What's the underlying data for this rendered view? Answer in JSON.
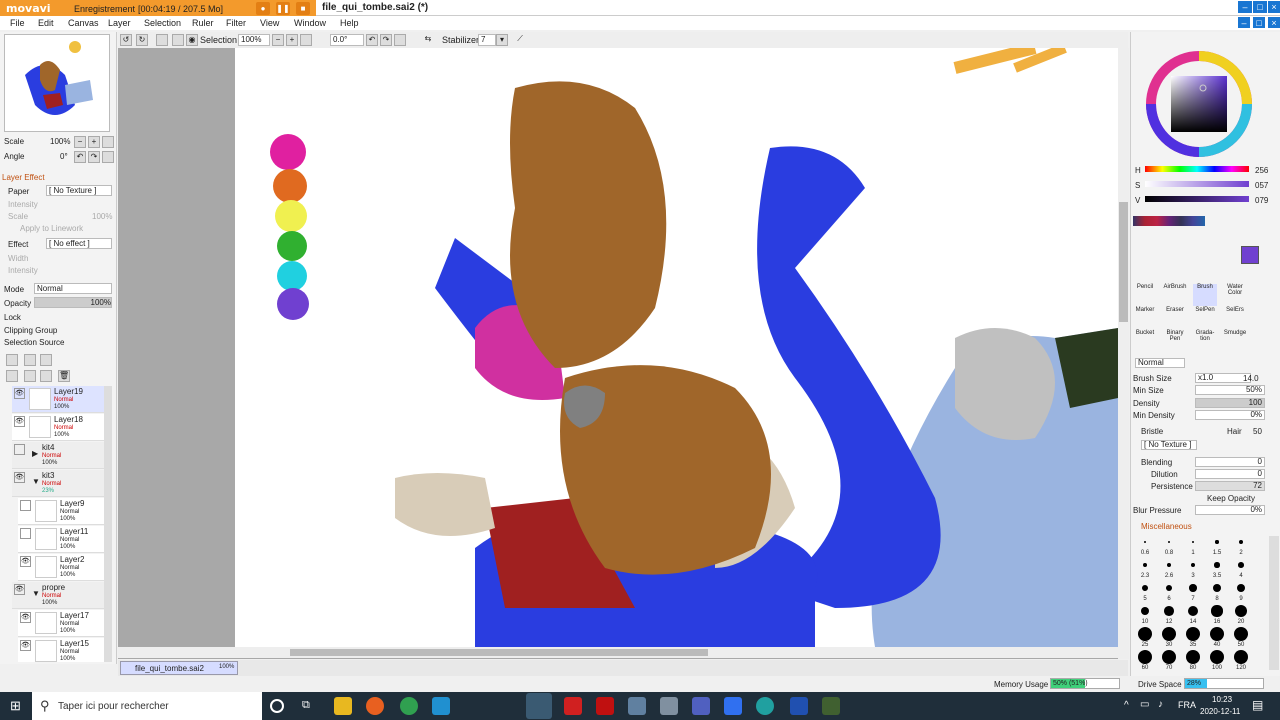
{
  "recorder": {
    "logo": "movavi",
    "label": "Enregistrement",
    "time": "[00:04:19 / 207.5 Mo]"
  },
  "title": "file_qui_tombe.sai2 (*)",
  "menu": [
    "File",
    "Edit",
    "Canvas",
    "Layer",
    "Selection",
    "Ruler",
    "Filter",
    "View",
    "Window",
    "Help"
  ],
  "toolbar": {
    "selection": "Selection",
    "zoom": "100%",
    "angle": "0.0°",
    "stabilizer_label": "Stabilizer",
    "stabilizer_value": "7"
  },
  "navigator": {
    "scale_label": "Scale",
    "scale_value": "100%",
    "angle_label": "Angle",
    "angle_value": "0°"
  },
  "layer_effect": {
    "title": "Layer Effect",
    "paper_label": "Paper",
    "paper_value": "[ No Texture ]",
    "intensity": "Intensity",
    "scale": "Scale",
    "scale_value": "100%",
    "apply": "Apply to Linework",
    "effect_label": "Effect",
    "effect_value": "[ No effect ]",
    "width": "Width",
    "intensity2": "Intensity"
  },
  "layer_props": {
    "mode_label": "Mode",
    "mode_value": "Normal",
    "opacity_label": "Opacity",
    "opacity_value": "100%",
    "lock_label": "Lock",
    "clipping": "Clipping Group",
    "selection_source": "Selection Source"
  },
  "layers": [
    {
      "name": "Layer19",
      "mode": "Normal",
      "opacity": "100%"
    },
    {
      "name": "Layer18",
      "mode": "Normal",
      "opacity": "100%"
    },
    {
      "name": "kit4",
      "mode": "Normal",
      "opacity": "100%"
    },
    {
      "name": "kit3",
      "mode": "Normal",
      "opacity": "23%"
    },
    {
      "name": "Layer9",
      "mode": "Normal",
      "opacity": "100%"
    },
    {
      "name": "Layer11",
      "mode": "Normal",
      "opacity": "100%"
    },
    {
      "name": "Layer2",
      "mode": "Normal",
      "opacity": "100%"
    },
    {
      "name": "propre",
      "mode": "Normal",
      "opacity": "100%"
    },
    {
      "name": "Layer17",
      "mode": "Normal",
      "opacity": "100%"
    },
    {
      "name": "Layer15",
      "mode": "Normal",
      "opacity": "100%"
    }
  ],
  "file_tab": {
    "name": "file_qui_tombe.sai2",
    "zoom": "100%"
  },
  "colors": {
    "swatch1": "#e020a0",
    "swatch2": "#e06a20",
    "swatch3": "#f0f050",
    "swatch4": "#30b030",
    "swatch5": "#20d0e0",
    "swatch6": "#7040d0",
    "current": "#7040d0"
  },
  "hsv": {
    "h_label": "H",
    "h_value": "256",
    "s_label": "S",
    "s_value": "057",
    "v_label": "V",
    "v_value": "079"
  },
  "tools": [
    "Pencil",
    "AirBrush",
    "Brush",
    "Water Color",
    "Marker",
    "Eraser",
    "SelPen",
    "SelErs",
    "Bucket",
    "Binary Pen",
    "Grada-tion",
    "Smudge"
  ],
  "brush": {
    "blend_mode": "Normal",
    "size_label": "Brush Size",
    "size_mult": "x1.0",
    "size_value": "14.0",
    "min_size_label": "Min Size",
    "min_size_value": "50%",
    "density_label": "Density",
    "density_value": "100",
    "min_density_label": "Min Density",
    "min_density_value": "0%",
    "bristle_label": "Bristle",
    "hair_label": "Hair",
    "hair_value": "50",
    "texture_value": "[ No Texture ]",
    "blending_label": "Blending",
    "blending_value": "0",
    "dilution_label": "Dilution",
    "dilution_value": "0",
    "persistence_label": "Persistence",
    "persistence_value": "72",
    "keep_opacity": "Keep Opacity",
    "blur_label": "Blur Pressure",
    "blur_value": "0%",
    "misc": "Miscellaneous"
  },
  "brush_sizes": [
    "0.6",
    "0.8",
    "1",
    "1.5",
    "2",
    "2.3",
    "2.6",
    "3",
    "3.5",
    "4",
    "5",
    "6",
    "7",
    "8",
    "9",
    "10",
    "12",
    "14",
    "16",
    "20",
    "25",
    "30",
    "35",
    "40",
    "50",
    "60",
    "70",
    "80",
    "100",
    "120"
  ],
  "status": {
    "memory_label": "Memory Usage",
    "memory_value": "50% (51%)",
    "memory_fraction": 0.5,
    "drive_label": "Drive Space",
    "drive_value": "28%",
    "drive_fraction": 0.28
  },
  "taskbar": {
    "search_placeholder": "Taper ici pour rechercher",
    "lang": "FRA",
    "time": "10:23",
    "date": "2020-12-11"
  }
}
